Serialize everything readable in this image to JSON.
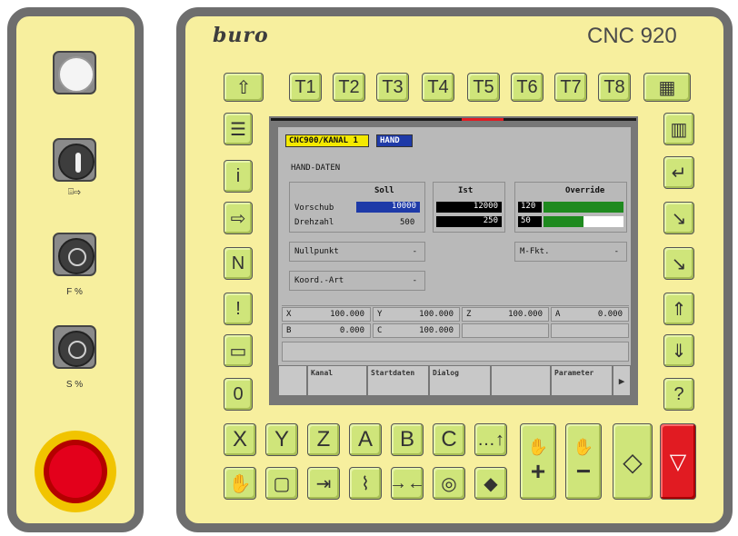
{
  "left_panel": {
    "labels": [
      "⌹⇨",
      "F %",
      "S %"
    ]
  },
  "header": {
    "logo": "buro",
    "model": "CNC 920"
  },
  "top_keys": [
    "⇧",
    "T1",
    "T2",
    "T3",
    "T4",
    "T5",
    "T6",
    "T7",
    "T8",
    "▦"
  ],
  "left_keys": [
    "☰",
    "i",
    "⇨",
    "N",
    "!",
    "▭",
    "0"
  ],
  "right_keys": [
    "▥",
    "↵",
    "↘",
    "↘",
    "⇑",
    "⇓",
    "?"
  ],
  "screen": {
    "channel": "CNC900/KANAL 1",
    "mode": "HAND",
    "title": "HAND-DATEN",
    "soll_header": "Soll",
    "ist_header": "Ist",
    "override_header": "Override",
    "vorschub_label": "Vorschub",
    "drehzahl_label": "Drehzahl",
    "vorschub_soll": "10000",
    "drehzahl_soll": "500",
    "vorschub_ist": "12000",
    "drehzahl_ist": "250",
    "override_feed": "120",
    "override_spindle": "50",
    "override_feed_pct": 1.0,
    "override_spindle_pct": 0.5,
    "nullpunkt_label": "Nullpunkt",
    "nullpunkt_value": "-",
    "mfkt_label": "M-Fkt.",
    "mfkt_value": "-",
    "koord_label": "Koord.-Art",
    "koord_value": "-",
    "axes_row1": [
      [
        "X",
        "100.000"
      ],
      [
        "Y",
        "100.000"
      ],
      [
        "Z",
        "100.000"
      ],
      [
        "A",
        "0.000"
      ]
    ],
    "axes_row2": [
      [
        "B",
        "0.000"
      ],
      [
        "C",
        "100.000"
      ]
    ]
  },
  "softkeys": [
    "",
    "Kanal",
    "Startdaten",
    "Dialog",
    "",
    "Parameter",
    "▶"
  ],
  "bottom_row1": [
    "X",
    "Y",
    "Z",
    "A",
    "B",
    "C",
    "…↑"
  ],
  "bottom_row2": [
    "✋",
    "▢",
    "⇥",
    "⌇",
    "→←",
    "◎",
    "◆"
  ],
  "jog": [
    "+",
    "−"
  ],
  "start_symbol": "◇",
  "stop_symbol": "▽"
}
